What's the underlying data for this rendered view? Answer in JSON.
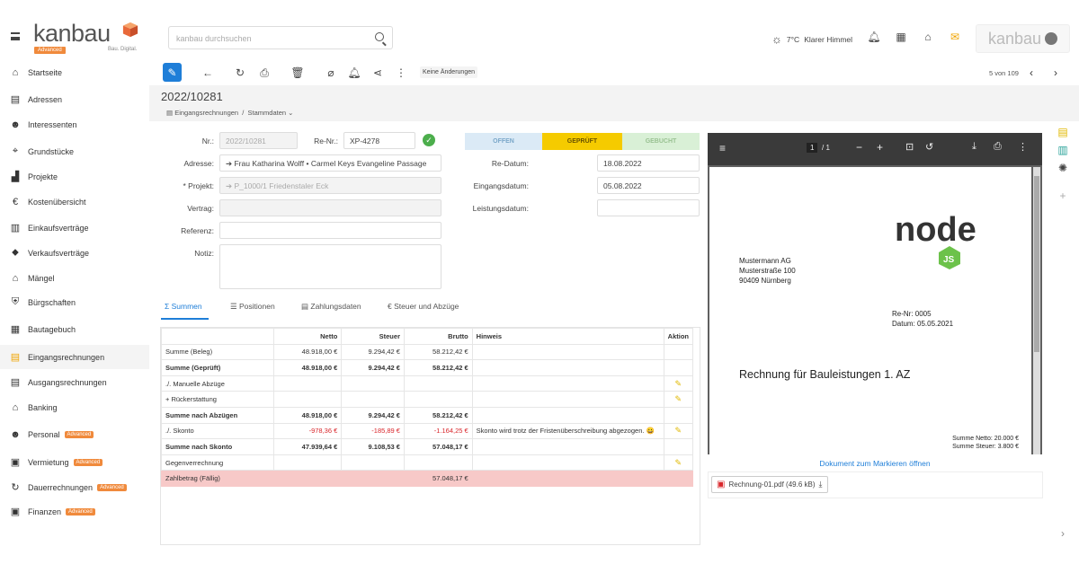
{
  "brand": {
    "name": "kanbau",
    "badge": "Advanced",
    "sub": "Bau. Digital."
  },
  "search": {
    "placeholder": "kanbau durchsuchen"
  },
  "weather": {
    "temp": "7°C",
    "text": "Klarer Himmel"
  },
  "user": {
    "name": "kanbau"
  },
  "sidebar": {
    "items": [
      {
        "label": "Startseite",
        "icon": "home-icon"
      },
      {
        "label": "Adressen",
        "icon": "address-book-icon"
      },
      {
        "label": "Interessenten",
        "icon": "people-icon"
      },
      {
        "label": "Grundstücke",
        "icon": "plot-icon"
      },
      {
        "label": "Projekte",
        "icon": "building-icon"
      },
      {
        "label": "Kostenübersicht",
        "icon": "euro-icon"
      },
      {
        "label": "Einkaufsverträge",
        "icon": "contract-icon"
      },
      {
        "label": "Verkaufsverträge",
        "icon": "tag-icon"
      },
      {
        "label": "Mängel",
        "icon": "house-defect-icon"
      },
      {
        "label": "Bürgschaften",
        "icon": "shield-icon"
      },
      {
        "label": "Bautagebuch",
        "icon": "calendar-icon"
      },
      {
        "label": "Eingangsrechnungen",
        "icon": "invoice-in-icon"
      },
      {
        "label": "Ausgangsrechnungen",
        "icon": "invoice-out-icon"
      },
      {
        "label": "Banking",
        "icon": "bank-icon"
      },
      {
        "label": "Personal",
        "icon": "staff-icon",
        "badge": "Advanced"
      },
      {
        "label": "Vermietung",
        "icon": "rental-icon",
        "badge": "Advanced"
      },
      {
        "label": "Dauerrechnungen",
        "icon": "recurring-icon",
        "badge": "Advanced"
      },
      {
        "label": "Finanzen",
        "icon": "finance-icon",
        "badge": "Advanced"
      }
    ]
  },
  "toolbar": {
    "no_changes": "Keine Änderungen",
    "pager": "5 von 109"
  },
  "header": {
    "doc_id": "2022/10281",
    "crumb_root": "Eingangsrechnungen",
    "crumb_sep": "/",
    "crumb_current": "Stammdaten ⌄"
  },
  "form": {
    "nr_label": "Nr.:",
    "nr_value": "2022/10281",
    "renr_label": "Re-Nr.:",
    "renr_value": "XP-4278",
    "adresse_label": "Adresse:",
    "adresse_value": "➔ Frau Katharina Wolff • Carmel Keys Evangeline Passage",
    "projekt_label": "* Projekt:",
    "projekt_value": "➔ P_1000/1 Friedenstaler Eck",
    "vertrag_label": "Vertrag:",
    "referenz_label": "Referenz:",
    "notiz_label": "Notiz:",
    "redatum_label": "Re-Datum:",
    "redatum_value": "18.08.2022",
    "eingang_label": "Eingangsdatum:",
    "eingang_value": "05.08.2022",
    "leistung_label": "Leistungsdatum:"
  },
  "status": {
    "open": "OFFEN",
    "checked": "GEPRÜFT",
    "booked": "GEBUCHT"
  },
  "tabs": [
    {
      "label": "Σ  Summen"
    },
    {
      "label": "☰  Positionen"
    },
    {
      "label": "▤  Zahlungsdaten"
    },
    {
      "label": "€  Steuer und Abzüge"
    }
  ],
  "table": {
    "headers": [
      "",
      "Netto",
      "Steuer",
      "Brutto",
      "Hinweis",
      "Aktion"
    ],
    "rows": [
      {
        "label": "Summe (Beleg)",
        "netto": "48.918,00 €",
        "steuer": "9.294,42 €",
        "brutto": "58.212,42 €",
        "hinweis": "",
        "edit": false
      },
      {
        "label": "Summe (Geprüft)",
        "netto": "48.918,00 €",
        "steuer": "9.294,42 €",
        "brutto": "58.212,42 €",
        "hinweis": "",
        "edit": false
      },
      {
        "label": "./. Manuelle Abzüge",
        "netto": "",
        "steuer": "",
        "brutto": "",
        "hinweis": "",
        "edit": true
      },
      {
        "label": "+ Rückerstattung",
        "netto": "",
        "steuer": "",
        "brutto": "",
        "hinweis": "",
        "edit": true
      },
      {
        "label": "Summe nach Abzügen",
        "netto": "48.918,00 €",
        "steuer": "9.294,42 €",
        "brutto": "58.212,42 €",
        "hinweis": "",
        "edit": false
      },
      {
        "label": "./. Skonto",
        "netto": "-978,36 €",
        "steuer": "-185,89 €",
        "brutto": "-1.164,25 €",
        "hinweis": "Skonto wird trotz der Fristenüberschreibung abgezogen. 😀",
        "edit": true
      },
      {
        "label": "Summe nach Skonto",
        "netto": "47.939,64 €",
        "steuer": "9.108,53 €",
        "brutto": "57.048,17 €",
        "hinweis": "",
        "edit": false
      },
      {
        "label": "Gegenverrechnung",
        "netto": "",
        "steuer": "",
        "brutto": "",
        "hinweis": "",
        "edit": true
      },
      {
        "label": "Zahlbetrag (Fällig)",
        "netto": "",
        "steuer": "",
        "brutto": "57.048,17 €",
        "hinweis": "",
        "edit": false
      }
    ]
  },
  "pdf": {
    "page_current": "1",
    "page_total": "/ 1",
    "sender_1": "Mustermann AG",
    "sender_2": "Musterstraße 100",
    "sender_3": "90409 Nürnberg",
    "renr": "Re-Nr: 0005",
    "datum": "Datum: 05.05.2021",
    "title": "Rechnung für Bauleistungen 1. AZ",
    "sum_netto": "Summe Netto: 20.000 €",
    "sum_steuer": "Summe Steuer: 3.800 €",
    "logo_text": "node",
    "logo_js": "JS",
    "open_link": "Dokument zum Markieren öffnen",
    "file": "Rechnung-01.pdf (49.6 kB)"
  },
  "colors": {
    "accent": "#1e7ed8",
    "orange": "#f08a3c",
    "checked": "#f5cb00",
    "open": "#dbeaf6",
    "booked": "#d9f0d6"
  }
}
